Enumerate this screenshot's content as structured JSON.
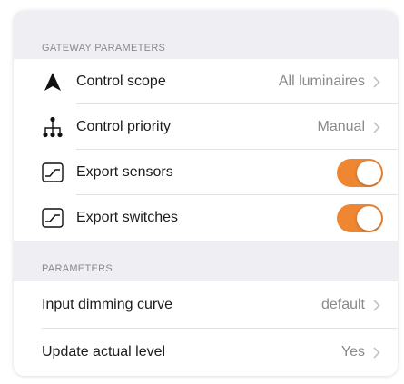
{
  "gateway": {
    "header": "GATEWAY PARAMETERS",
    "rows": [
      {
        "label": "Control scope",
        "value": "All luminaires",
        "icon": "arrow-up-icon",
        "control": "chevron"
      },
      {
        "label": "Control priority",
        "value": "Manual",
        "icon": "hierarchy-icon",
        "control": "chevron"
      },
      {
        "label": "Export sensors",
        "icon": "curve-icon",
        "control": "toggle",
        "on": true
      },
      {
        "label": "Export switches",
        "icon": "curve-icon",
        "control": "toggle",
        "on": true
      }
    ]
  },
  "parameters": {
    "header": "PARAMETERS",
    "rows": [
      {
        "label": "Input dimming curve",
        "value": "default",
        "control": "chevron"
      },
      {
        "label": "Update actual level",
        "value": "Yes",
        "control": "chevron"
      }
    ]
  },
  "colors": {
    "accent": "#ef8632",
    "background": "#efeff3",
    "secondary_text": "#8a8a8e"
  }
}
